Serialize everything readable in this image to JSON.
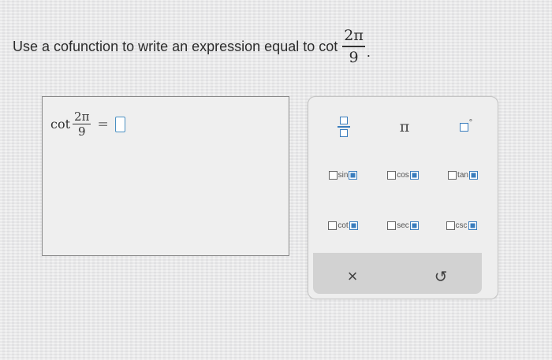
{
  "prompt": {
    "text": "Use a cofunction to write an expression equal to cot",
    "numerator": "2π",
    "denominator": "9",
    "period": "."
  },
  "answer": {
    "func": "cot",
    "numerator": "2π",
    "denominator": "9",
    "equals": "="
  },
  "keypad": {
    "pi": "π",
    "degree": "°",
    "trig": {
      "sin": "sin",
      "cos": "cos",
      "tan": "tan",
      "cot": "cot",
      "sec": "sec",
      "csc": "csc"
    },
    "clear": "×",
    "undo": "↺"
  },
  "colors": {
    "accent": "#3a7dbd",
    "background": "#e9e9ea"
  }
}
